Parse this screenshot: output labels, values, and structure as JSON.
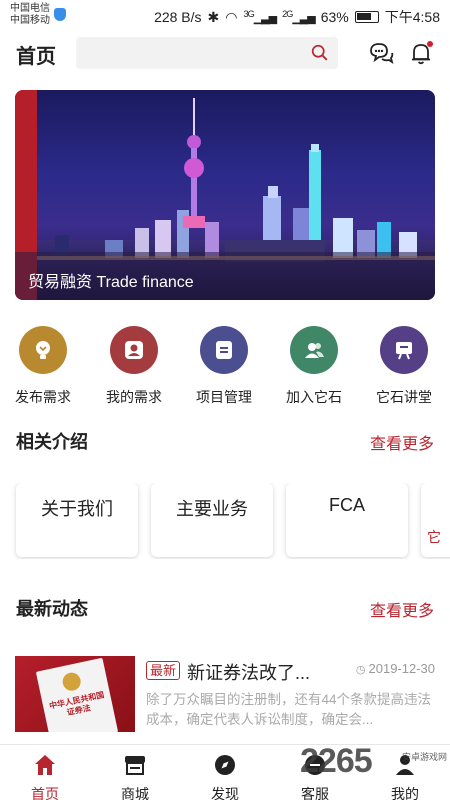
{
  "status_bar": {
    "carrier_1": "中国电信",
    "carrier_2": "中国移动",
    "speed": "228 B/s",
    "net_1": "3G",
    "net_2": "2G",
    "battery": "63%",
    "time": "下午4:58"
  },
  "header": {
    "title": "首页",
    "search_placeholder": ""
  },
  "banner": {
    "caption": "贸易融资 Trade finance"
  },
  "quick_actions": [
    {
      "label": "发布需求",
      "color": "#b9892f"
    },
    {
      "label": "我的需求",
      "color": "#a43b3f"
    },
    {
      "label": "项目管理",
      "color": "#4b4f8f"
    },
    {
      "label": "加入它石",
      "color": "#3f8766"
    },
    {
      "label": "它石讲堂",
      "color": "#553f86"
    }
  ],
  "intro": {
    "title": "相关介绍",
    "more": "查看更多",
    "cards": [
      "关于我们",
      "主要业务",
      "FCA",
      "它"
    ]
  },
  "news": {
    "title": "最新动态",
    "more": "查看更多",
    "items": [
      {
        "badge": "最新",
        "title": "新证券法改了...",
        "date": "2019-12-30",
        "desc": "除了万众瞩目的注册制，还有44个条款提高违法成本，确定代表人诉讼制度，确定会...",
        "thumb_text": "中华人民共和国证券法"
      }
    ]
  },
  "tabbar": [
    {
      "label": "首页",
      "active": true
    },
    {
      "label": "商城",
      "active": false
    },
    {
      "label": "发现",
      "active": false
    },
    {
      "label": "客服",
      "active": false
    },
    {
      "label": "我的",
      "active": false
    }
  ],
  "watermark": {
    "text": "2265",
    "sub": "安卓游戏网"
  },
  "colors": {
    "accent": "#b7262f"
  }
}
